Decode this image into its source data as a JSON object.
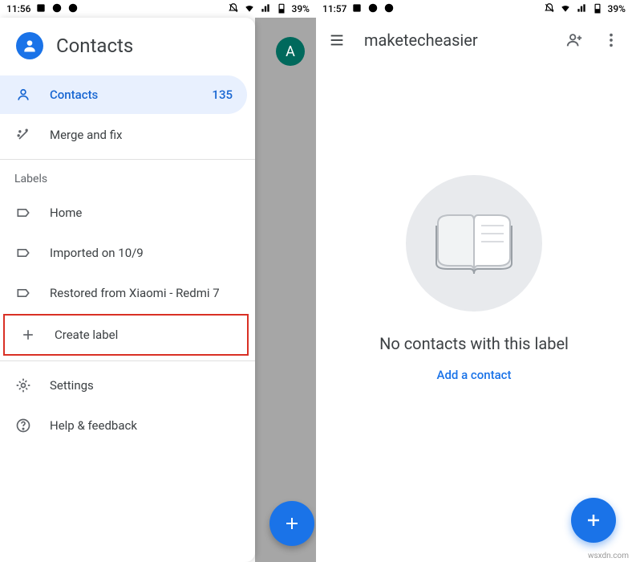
{
  "left": {
    "status": {
      "time": "11:56",
      "battery": "39%"
    },
    "drawer": {
      "title": "Contacts",
      "nav_contacts": {
        "label": "Contacts",
        "count": "135"
      },
      "nav_merge": "Merge and fix",
      "labels_header": "Labels",
      "label_home": "Home",
      "label_imported": "Imported on 10/9",
      "label_restored": "Restored from Xiaomi - Redmi 7",
      "create_label": "Create label",
      "settings": "Settings",
      "help": "Help & feedback"
    },
    "avatar_letter": "A"
  },
  "right": {
    "status": {
      "time": "11:57",
      "battery": "39%"
    },
    "appbar": {
      "title": "maketecheasier"
    },
    "empty": {
      "title": "No contacts with this label",
      "action": "Add a contact"
    }
  },
  "watermark": "wsxdn.com"
}
